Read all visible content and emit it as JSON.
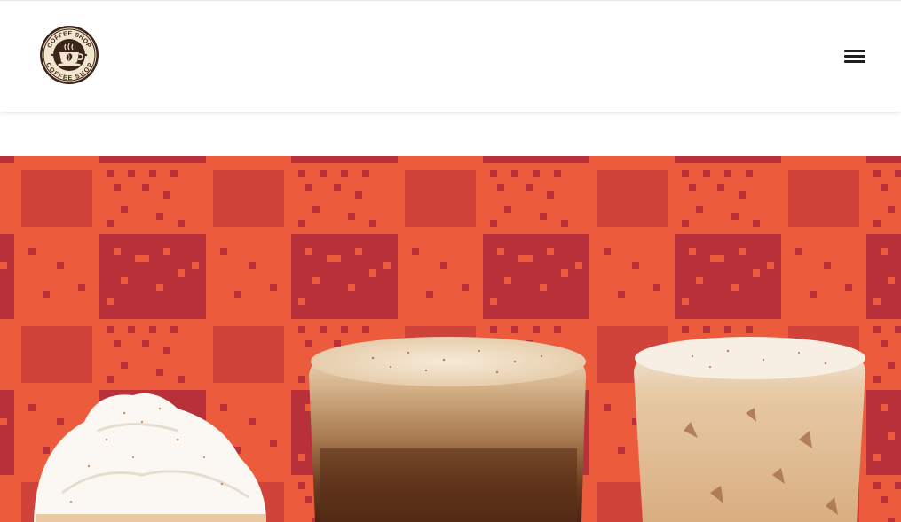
{
  "brand": {
    "name": "Coffee Shop",
    "logo_text_top": "COFFEE SHOP",
    "logo_text_bottom": "COFFEE SHOP",
    "logo_icon": "coffee-cup-icon"
  },
  "header": {
    "menu_icon": "hamburger-menu-icon"
  },
  "hero": {
    "pattern_colors": {
      "base": "#b8303a",
      "plaid": "#ec5b3c"
    },
    "drinks": [
      {
        "name": "whipped-cream-drink"
      },
      {
        "name": "layered-iced-espresso"
      },
      {
        "name": "iced-latte"
      }
    ]
  }
}
